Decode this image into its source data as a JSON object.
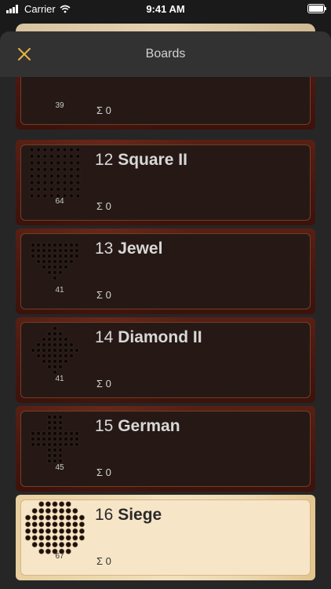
{
  "status": {
    "carrier": "Carrier",
    "time": "9:41 AM"
  },
  "nav": {
    "title": "Boards"
  },
  "boards": [
    {
      "number": "",
      "name": "",
      "pegs": "39",
      "sum_symbol": "Σ",
      "sum_value": "0",
      "shape": "partial-top"
    },
    {
      "number": "12",
      "name": "Square II",
      "pegs": "64",
      "sum_symbol": "Σ",
      "sum_value": "0",
      "shape": "square"
    },
    {
      "number": "13",
      "name": "Jewel",
      "pegs": "41",
      "sum_symbol": "Σ",
      "sum_value": "0",
      "shape": "jewel"
    },
    {
      "number": "14",
      "name": "Diamond II",
      "pegs": "41",
      "sum_symbol": "Σ",
      "sum_value": "0",
      "shape": "diamond"
    },
    {
      "number": "15",
      "name": "German",
      "pegs": "45",
      "sum_symbol": "Σ",
      "sum_value": "0",
      "shape": "cross"
    },
    {
      "number": "16",
      "name": "Siege",
      "pegs": "67",
      "sum_symbol": "Σ",
      "sum_value": "0",
      "shape": "siege",
      "selected": true
    }
  ],
  "colors": {
    "background": "#1a1a1a",
    "nav_bar": "#323232",
    "card_wood": "#4a170f",
    "card_face": "#261915",
    "selected_face": "#f7e5c8",
    "close_accent": "#e5b44a"
  },
  "icons": {
    "close": "close-x-icon",
    "signal": "signal-icon",
    "wifi": "wifi-icon",
    "battery": "battery-icon"
  }
}
